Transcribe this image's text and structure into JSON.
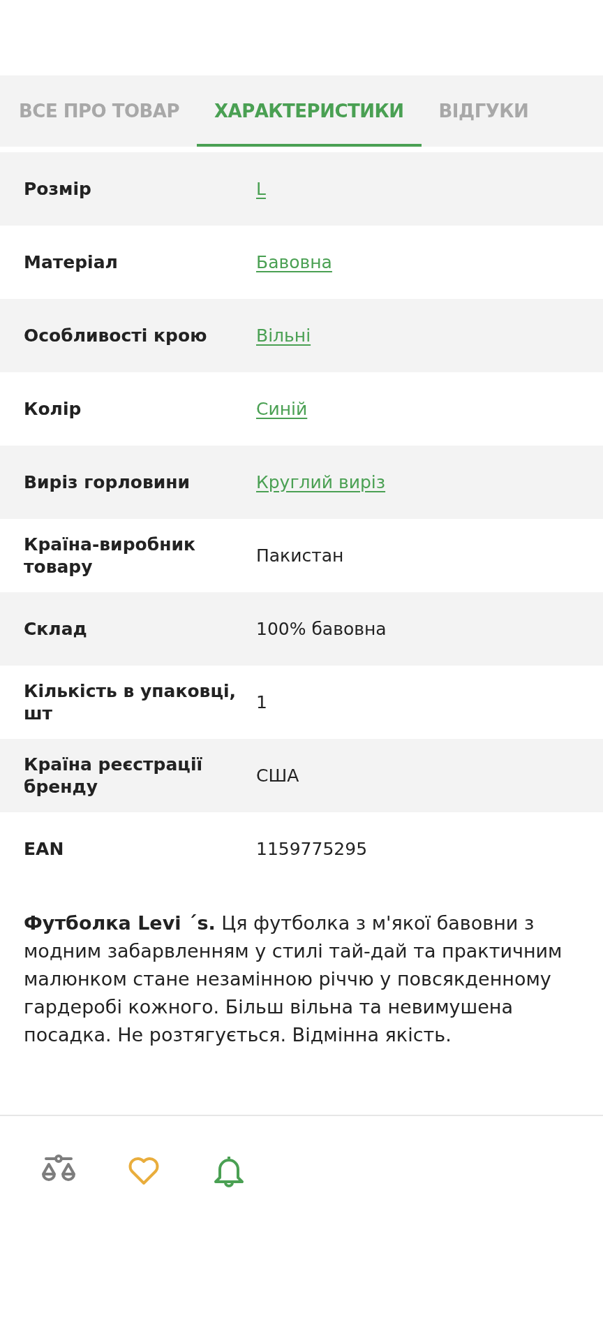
{
  "tabs": [
    {
      "label": "ВСЕ ПРО ТОВАР",
      "selected": false
    },
    {
      "label": "ХАРАКТЕРИСТИКИ",
      "selected": true
    },
    {
      "label": "ВІДГУКИ",
      "selected": false
    }
  ],
  "specs": [
    {
      "name": "Розмір",
      "value": "L",
      "link": true
    },
    {
      "name": "Матеріал",
      "value": "Бавовна",
      "link": true
    },
    {
      "name": "Особливості крою",
      "value": "Вільні",
      "link": true
    },
    {
      "name": "Колір",
      "value": "Синій",
      "link": true
    },
    {
      "name": "Виріз горловини",
      "value": "Круглий виріз",
      "link": true
    },
    {
      "name": "Країна-виробник товару",
      "value": "Пакистан",
      "link": false
    },
    {
      "name": "Склад",
      "value": "100% бавовна",
      "link": false
    },
    {
      "name": "Кількість в упаковці, шт",
      "value": "1",
      "link": false
    },
    {
      "name": "Країна реєстрації бренду",
      "value": "США",
      "link": false
    },
    {
      "name": "EAN",
      "value": "1159775295",
      "link": false
    }
  ],
  "description": "**Футболка Levi ´s.** Ця футболка з м'якої бавовни з модним забарвленням у стилі тай-дай та практичним малюнком стане незамінною річчю у повсякденному гардеробі кожного. Більш вільна та невимушена посадка. Не розтягується. Відмінна якість.",
  "actions": [
    {
      "kind": "compare"
    },
    {
      "kind": "favorite"
    },
    {
      "kind": "notify"
    }
  ]
}
